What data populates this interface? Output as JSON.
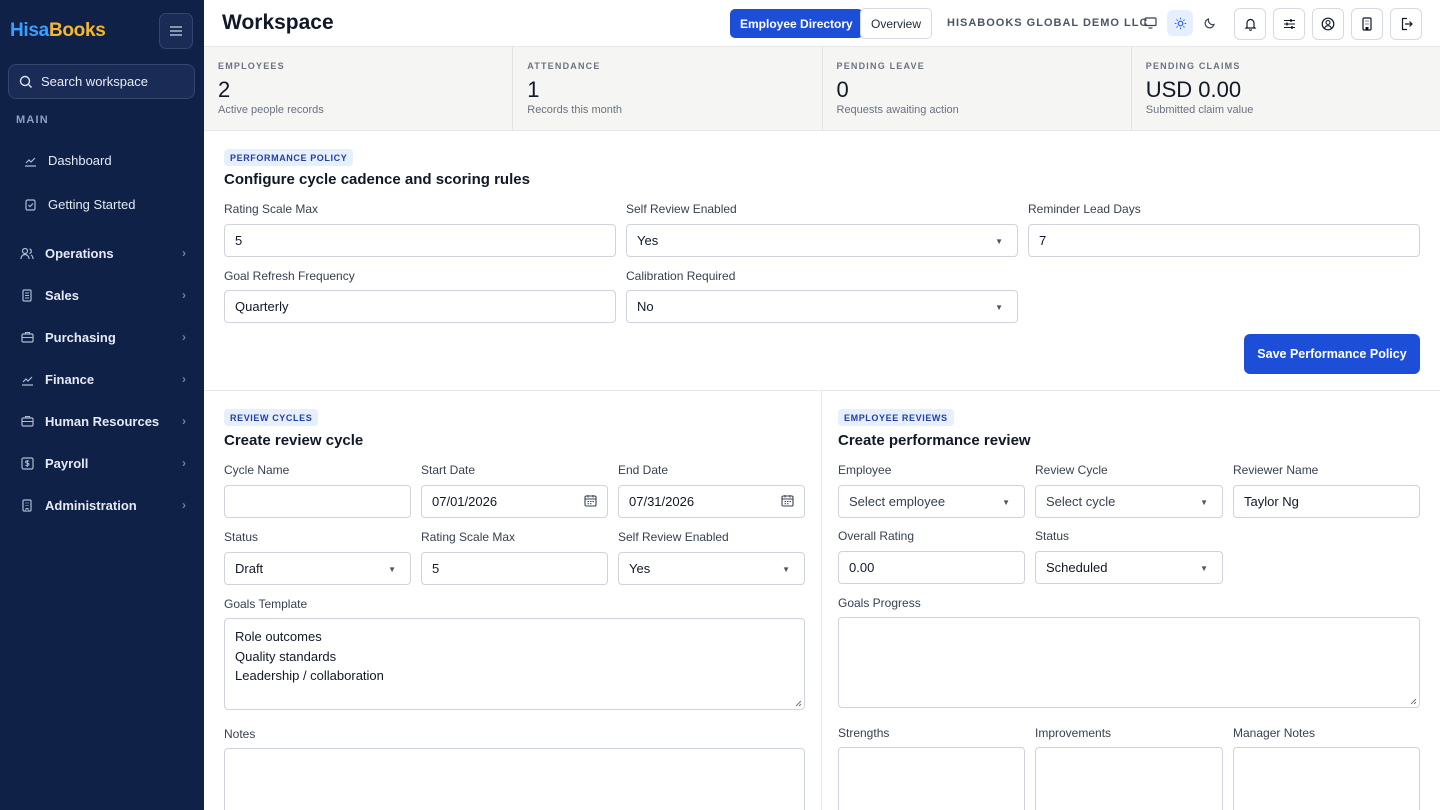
{
  "brand": {
    "part1": "Hisa",
    "part2": "Books"
  },
  "sidebar": {
    "search_placeholder": "Search workspace",
    "section_label": "MAIN",
    "items": [
      {
        "label": "Dashboard",
        "icon": "chart-line-icon"
      },
      {
        "label": "Getting Started",
        "icon": "clipboard-check-icon"
      },
      {
        "label": "Operations",
        "icon": "users-icon"
      },
      {
        "label": "Sales",
        "icon": "receipt-icon"
      },
      {
        "label": "Purchasing",
        "icon": "briefcase-icon"
      },
      {
        "label": "Finance",
        "icon": "chart-line-icon"
      },
      {
        "label": "Human Resources",
        "icon": "briefcase-icon"
      },
      {
        "label": "Payroll",
        "icon": "dollar-icon"
      },
      {
        "label": "Administration",
        "icon": "building-icon"
      }
    ]
  },
  "header": {
    "title": "Workspace",
    "employee_directory": "Employee Directory",
    "overview": "Overview",
    "company": "HISABOOKS GLOBAL DEMO LLC"
  },
  "stats": [
    {
      "label": "EMPLOYEES",
      "value": "2",
      "desc": "Active people records"
    },
    {
      "label": "ATTENDANCE",
      "value": "1",
      "desc": "Records this month"
    },
    {
      "label": "PENDING LEAVE",
      "value": "0",
      "desc": "Requests awaiting action"
    },
    {
      "label": "PENDING CLAIMS",
      "value": "USD 0.00",
      "desc": "Submitted claim value"
    }
  ],
  "policy": {
    "tag": "PERFORMANCE POLICY",
    "title": "Configure cycle cadence and scoring rules",
    "rating_scale_max_label": "Rating Scale Max",
    "rating_scale_max": "5",
    "self_review_label": "Self Review Enabled",
    "self_review": "Yes",
    "reminder_label": "Reminder Lead Days",
    "reminder": "7",
    "goal_refresh_label": "Goal Refresh Frequency",
    "goal_refresh": "Quarterly",
    "calibration_label": "Calibration Required",
    "calibration": "No",
    "save": "Save Performance Policy"
  },
  "cycles": {
    "tag": "REVIEW CYCLES",
    "title": "Create review cycle",
    "cycle_name_label": "Cycle Name",
    "cycle_name": "",
    "start_date_label": "Start Date",
    "start_date": "07/01/2026",
    "end_date_label": "End Date",
    "end_date": "07/31/2026",
    "status_label": "Status",
    "status": "Draft",
    "rating_scale_label": "Rating Scale Max",
    "rating_scale": "5",
    "self_review_label": "Self Review Enabled",
    "self_review": "Yes",
    "goals_template_label": "Goals Template",
    "goals_template": [
      "Role outcomes",
      "Quality standards",
      "Leadership / collaboration"
    ],
    "notes_label": "Notes"
  },
  "reviews": {
    "tag": "EMPLOYEE REVIEWS",
    "title": "Create performance review",
    "employee_label": "Employee",
    "employee_placeholder": "Select employee",
    "cycle_label": "Review Cycle",
    "cycle_placeholder": "Select cycle",
    "reviewer_label": "Reviewer Name",
    "reviewer": "Taylor Ng",
    "overall_rating_label": "Overall Rating",
    "overall_rating": "0.00",
    "status_label": "Status",
    "status": "Scheduled",
    "goals_progress_label": "Goals Progress",
    "strengths_label": "Strengths",
    "improvements_label": "Improvements",
    "manager_notes_label": "Manager Notes"
  }
}
